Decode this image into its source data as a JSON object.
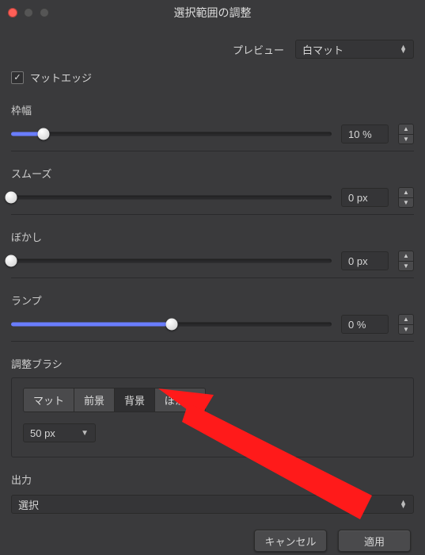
{
  "window": {
    "title": "選択範囲の調整"
  },
  "preview": {
    "label": "プレビュー",
    "value": "白マット"
  },
  "matte_edge": {
    "label": "マットエッジ",
    "checked": true
  },
  "sliders": {
    "width": {
      "label": "枠幅",
      "value": "10 %",
      "percent": 10
    },
    "smooth": {
      "label": "スムーズ",
      "value": "0 px",
      "percent": 0
    },
    "blur": {
      "label": "ぼかし",
      "value": "0 px",
      "percent": 0
    },
    "ramp": {
      "label": "ランプ",
      "value": "0 %",
      "percent": 50
    }
  },
  "brush": {
    "label": "調整ブラシ",
    "buttons": [
      "マット",
      "前景",
      "背景",
      "ぼかし"
    ],
    "active_index": 2,
    "size": "50 px"
  },
  "output": {
    "label": "出力",
    "value": "選択"
  },
  "footer": {
    "cancel": "キャンセル",
    "apply": "適用"
  }
}
